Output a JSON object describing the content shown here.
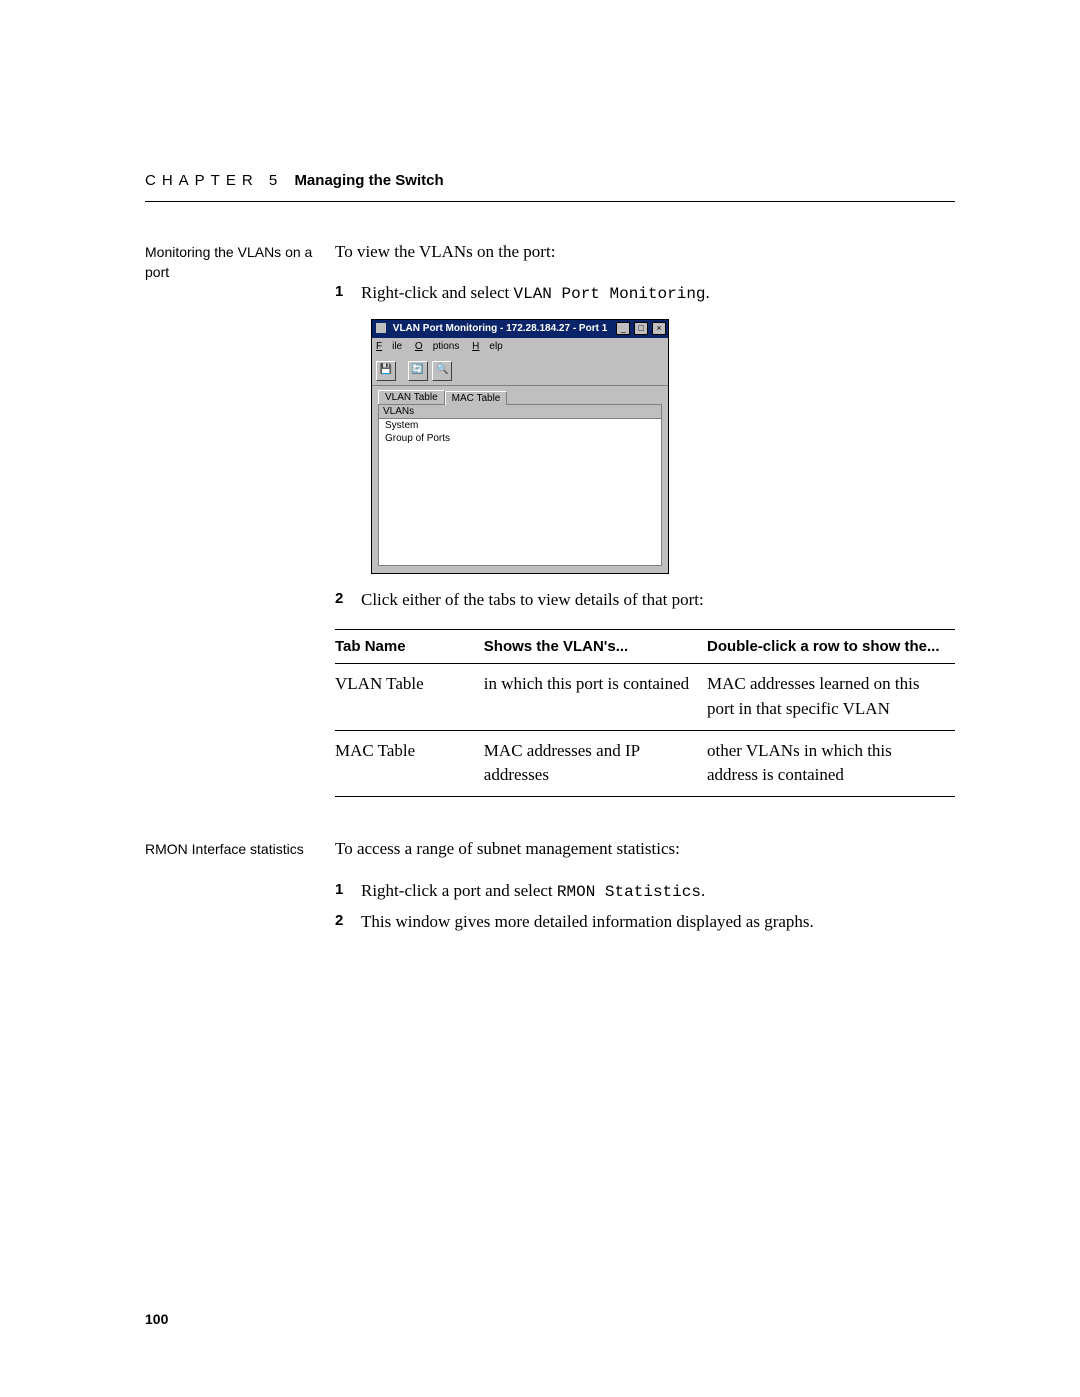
{
  "header": {
    "chapter": "CHAPTER 5",
    "title": "Managing the Switch"
  },
  "section1": {
    "side": "Monitoring the VLANs on a port",
    "intro": "To view the VLANs on the port:",
    "step1_prefix": "Right-click and select ",
    "step1_mono": "VLAN Port Monitoring",
    "step1_suffix": ".",
    "step2": "Click either of the tabs to view details of that port:"
  },
  "screenshot": {
    "title": "VLAN Port Monitoring - 172.28.184.27 - Port 1",
    "menu": {
      "file": "File",
      "options": "Options",
      "help": "Help",
      "f": "F",
      "o": "O",
      "h": "H"
    },
    "toolbar_icons": {
      "save": "💾",
      "refresh": "🔄",
      "search": "🔍"
    },
    "tabs": {
      "active": "VLAN Table",
      "inactive": "MAC Table"
    },
    "colhdr": "VLANs",
    "rows": {
      "r1": "System",
      "r2": "Group of Ports"
    },
    "win_btns": {
      "min": "_",
      "max": "□",
      "close": "×"
    }
  },
  "table": {
    "h1": "Tab Name",
    "h2": "Shows the VLAN's...",
    "h3": "Double-click a row to show the...",
    "r1c1": "VLAN Table",
    "r1c2": "in which this port is contained",
    "r1c3": "MAC addresses learned on this port in that specific VLAN",
    "r2c1": "MAC Table",
    "r2c2": "MAC addresses and IP addresses",
    "r2c3": "other VLANs in which this address is contained"
  },
  "section2": {
    "side": "RMON Interface statistics",
    "intro": "To access a range of subnet management statistics:",
    "step1_prefix": "Right-click a port and select ",
    "step1_mono": "RMON Statistics",
    "step1_suffix": ".",
    "step2": "This window gives more detailed information displayed as graphs."
  },
  "page_number": "100"
}
